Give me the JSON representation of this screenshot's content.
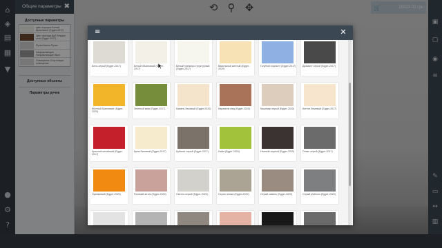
{
  "sidebar": {
    "title": "Общие параметры",
    "section_title": "Доступные параметры",
    "items": [
      {
        "label": "Цвет корпуса Белый Бриллиант (Egger-2017)",
        "color": "#eeeeea"
      },
      {
        "label": "Цвет фасада Дуб Вердал стоп (Egger 2017)",
        "color": "#6e4a32"
      },
      {
        "label": "Ручка Балка Ручка",
        "color": "#d4d4d4"
      },
      {
        "label": "Направляющие Направляющие Blum",
        "color": "#9a9a9a"
      },
      {
        "label": "Освещение Отсутствует освещение",
        "color": "#d9d9d9"
      }
    ],
    "available_objects": "Доступные объекты",
    "handle_params": "Параметры ручек"
  },
  "cart": {
    "amount": "20023.22 грн"
  },
  "swatches": [
    {
      "label": "Бело-серый (Egger-2017)",
      "color": "#dedbd4"
    },
    {
      "label": "Белый Лазиловый (Egger-2017)",
      "color": "#f3f1e7"
    },
    {
      "label": "Белый премиум структурный (Egger-2017)",
      "color": "#f7f6ee"
    },
    {
      "label": "Ванильный желтый (Egger-2020)",
      "color": "#f6e2b4"
    },
    {
      "label": "Голубой горизонт (Egger-2017)",
      "color": "#8eb0e3"
    },
    {
      "label": "Диамант серый (Egger-2017)",
      "color": "#494949"
    },
    {
      "label": "Жёлтый бриллиант (Egger-2020)",
      "color": "#f2b52a"
    },
    {
      "label": "Зеленый киви (Egger-2017)",
      "color": "#768d3b"
    },
    {
      "label": "Камень бежевый (Egger-2020)",
      "color": "#f4e4cb"
    },
    {
      "label": "Карамель мед (Egger-2020)",
      "color": "#a9735a"
    },
    {
      "label": "Кашемир серый (Egger-2020)",
      "color": "#ddcdbd"
    },
    {
      "label": "Коттон бежевый (Egger-2017)",
      "color": "#f7e6cd"
    },
    {
      "label": "Красный китайский (Egger-2017)",
      "color": "#c3202b"
    },
    {
      "label": "Крем бежевый (Egger-2017)",
      "color": "#f6eccd"
    },
    {
      "label": "Кубанит серый (Egger-2017)",
      "color": "#7b736a"
    },
    {
      "label": "Лайм (Egger-2020)",
      "color": "#a3c23b"
    },
    {
      "label": "Нежный черный (Egger-2020)",
      "color": "#3a3331"
    },
    {
      "label": "Оникс серый (Egger-2017)",
      "color": "#6b6b6b"
    },
    {
      "label": "Оранжевый (Egger-2020)",
      "color": "#f08a10"
    },
    {
      "label": "Розовый антик (Egger-2020)",
      "color": "#c9a29b"
    },
    {
      "label": "Светло-серый (Egger-2020)",
      "color": "#d3d1cb"
    },
    {
      "label": "Серая галька (Egger-2020)",
      "color": "#aba394"
    },
    {
      "label": "Серый камень (Egger-2020)",
      "color": "#9b8c81"
    },
    {
      "label": "Серый platinum (Egger-2020)",
      "color": "#7e7f80"
    },
    {
      "label": "",
      "color": "#e3e3e3"
    },
    {
      "label": "",
      "color": "#b4b4b4"
    },
    {
      "label": "",
      "color": "#8e8880"
    },
    {
      "label": "",
      "color": "#e5b3a5"
    },
    {
      "label": "",
      "color": "#181818"
    },
    {
      "label": "",
      "color": "#6a6a6a"
    }
  ]
}
